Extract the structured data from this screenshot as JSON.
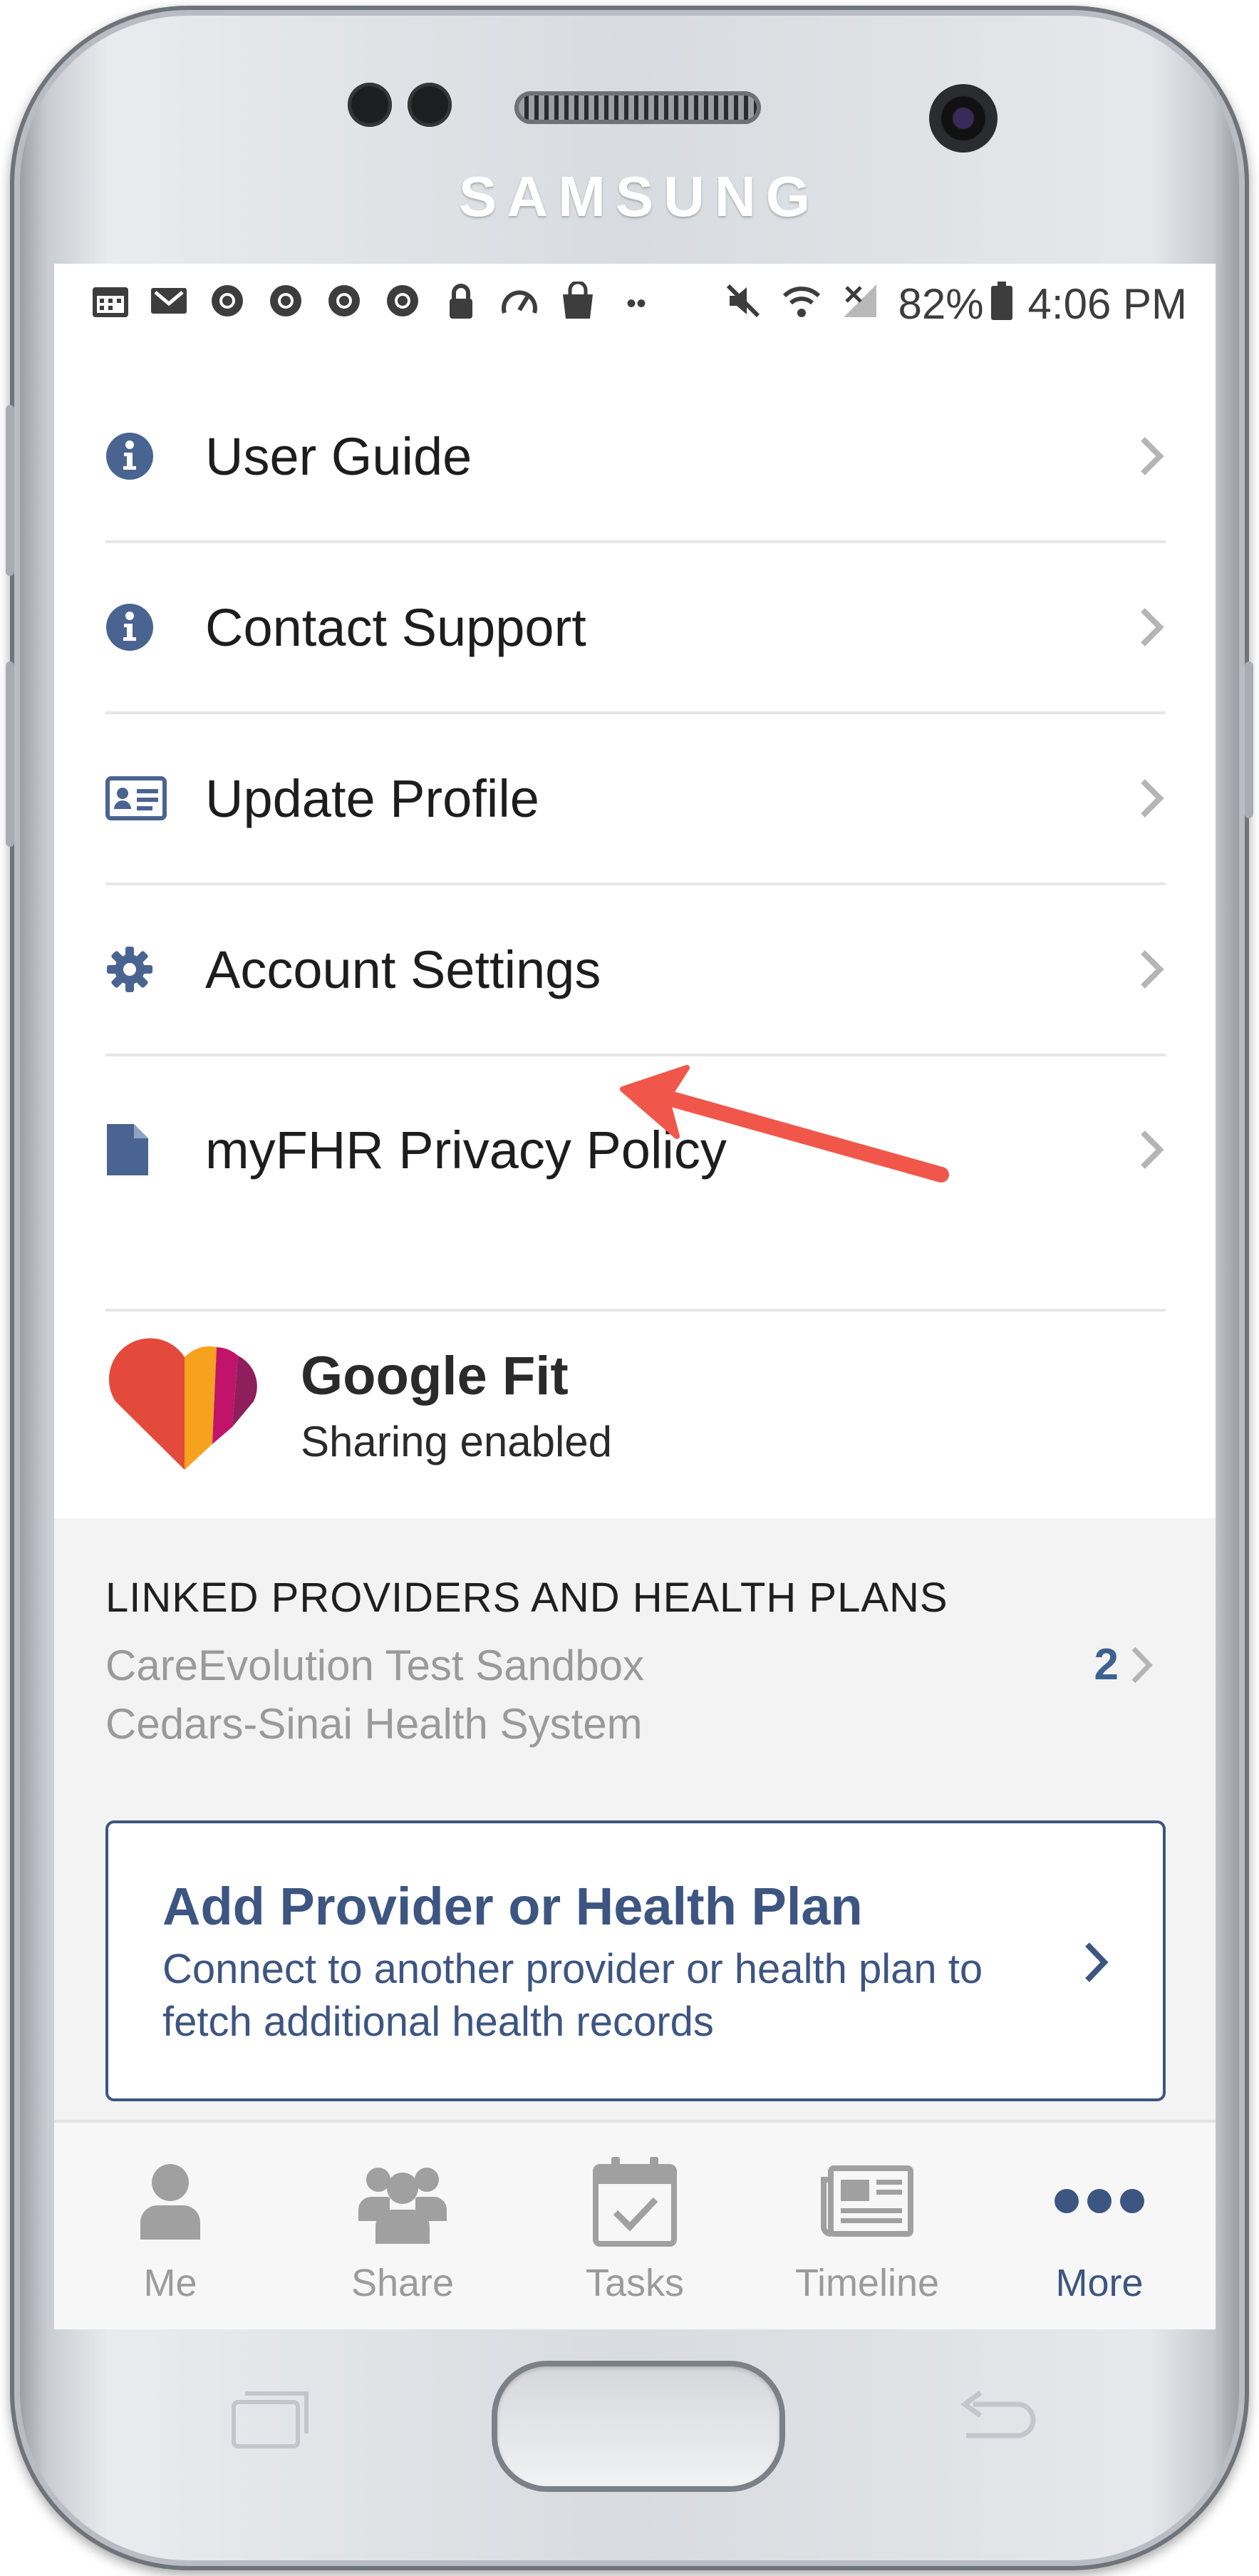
{
  "device": {
    "brand": "SAMSUNG"
  },
  "status_bar": {
    "notification_icons": [
      "calendar-icon",
      "mail-icon",
      "chrome-icon",
      "chrome-icon",
      "chrome-icon",
      "chrome-icon",
      "lock-icon",
      "speedometer-icon",
      "shopping-bag-icon",
      "more-dots-icon"
    ],
    "system_icons": [
      "mute-icon",
      "wifi-icon",
      "no-signal-icon",
      "battery-icon"
    ],
    "battery": "82%",
    "time": "4:06 PM"
  },
  "menu": {
    "items": [
      {
        "label": "User Guide",
        "icon": "info-circle-icon"
      },
      {
        "label": "Contact Support",
        "icon": "info-circle-icon"
      },
      {
        "label": "Update Profile",
        "icon": "id-card-icon"
      },
      {
        "label": "Account Settings",
        "icon": "gear-icon"
      },
      {
        "label": "myFHR Privacy Policy",
        "icon": "document-icon"
      }
    ]
  },
  "google_fit": {
    "title": "Google Fit",
    "status": "Sharing enabled",
    "icon": "google-fit-heart-icon"
  },
  "linked": {
    "heading": "LINKED PROVIDERS AND HEALTH PLANS",
    "providers": [
      "CareEvolution Test Sandbox",
      "Cedars-Sinai Health System"
    ],
    "count": "2"
  },
  "add_provider": {
    "title": "Add Provider or Health Plan",
    "description": "Connect to another provider or health plan to fetch additional health records"
  },
  "tabbar": {
    "tabs": [
      {
        "label": "Me",
        "icon": "person-icon"
      },
      {
        "label": "Share",
        "icon": "group-icon"
      },
      {
        "label": "Tasks",
        "icon": "calendar-check-icon"
      },
      {
        "label": "Timeline",
        "icon": "newspaper-icon"
      },
      {
        "label": "More",
        "icon": "more-dots-icon"
      }
    ],
    "active": "More"
  },
  "colors": {
    "accent": "#3d5581",
    "icon_blue": "#4a6491",
    "annotation_arrow": "#f0574a",
    "inactive_tab": "#9b9b9b"
  }
}
